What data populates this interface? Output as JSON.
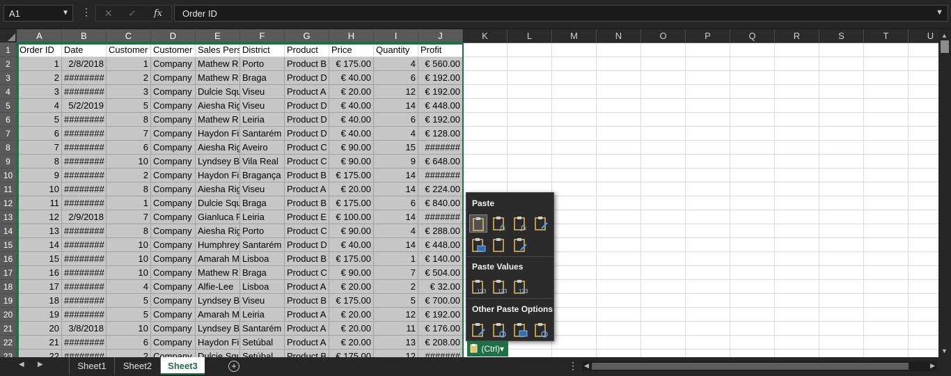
{
  "formula_bar": {
    "name_box": "A1",
    "fx_label": "fx",
    "formula": "Order ID"
  },
  "columns": [
    "A",
    "B",
    "C",
    "D",
    "E",
    "F",
    "G",
    "H",
    "I",
    "J",
    "K",
    "L",
    "M",
    "N",
    "O",
    "P",
    "Q",
    "R",
    "S",
    "T",
    "U"
  ],
  "rows": [
    "1",
    "2",
    "3",
    "4",
    "5",
    "6",
    "7",
    "8",
    "9",
    "10",
    "11",
    "12",
    "13",
    "14",
    "15",
    "16",
    "17",
    "18",
    "19",
    "20",
    "21",
    "22",
    "23"
  ],
  "table": {
    "headers": [
      "Order ID",
      "Date",
      "Customer",
      "Customer",
      "Sales Pers",
      "District",
      "Product",
      "Price",
      "Quantity",
      "Profit"
    ],
    "data": [
      [
        "1",
        "2/8/2018",
        "1",
        "Company",
        "Mathew R",
        "Porto",
        "Product B",
        "€ 175.00",
        "4",
        "€ 560.00"
      ],
      [
        "2",
        "########",
        "2",
        "Company",
        "Mathew R",
        "Braga",
        "Product D",
        "€   40.00",
        "6",
        "€ 192.00"
      ],
      [
        "3",
        "########",
        "3",
        "Company",
        "Dulcie Squ",
        "Viseu",
        "Product A",
        "€   20.00",
        "12",
        "€ 192.00"
      ],
      [
        "4",
        "5/2/2019",
        "5",
        "Company",
        "Aiesha Rig",
        "Viseu",
        "Product D",
        "€   40.00",
        "14",
        "€ 448.00"
      ],
      [
        "5",
        "########",
        "8",
        "Company",
        "Mathew R",
        "Leiria",
        "Product D",
        "€   40.00",
        "6",
        "€ 192.00"
      ],
      [
        "6",
        "########",
        "7",
        "Company",
        "Haydon Fi",
        "Santarém",
        "Product D",
        "€   40.00",
        "4",
        "€ 128.00"
      ],
      [
        "7",
        "########",
        "6",
        "Company",
        "Aiesha Rig",
        "Aveiro",
        "Product C",
        "€   90.00",
        "15",
        "#######"
      ],
      [
        "8",
        "########",
        "10",
        "Company",
        "Lyndsey B",
        "Vila Real",
        "Product C",
        "€   90.00",
        "9",
        "€ 648.00"
      ],
      [
        "9",
        "########",
        "2",
        "Company",
        "Haydon Fi",
        "Bragança",
        "Product B",
        "€ 175.00",
        "14",
        "#######"
      ],
      [
        "10",
        "########",
        "8",
        "Company",
        "Aiesha Rig",
        "Viseu",
        "Product A",
        "€   20.00",
        "14",
        "€ 224.00"
      ],
      [
        "11",
        "########",
        "1",
        "Company",
        "Dulcie Squ",
        "Braga",
        "Product B",
        "€ 175.00",
        "6",
        "€ 840.00"
      ],
      [
        "12",
        "2/9/2018",
        "7",
        "Company",
        "Gianluca F",
        "Leiria",
        "Product E",
        "€ 100.00",
        "14",
        "#######"
      ],
      [
        "13",
        "########",
        "8",
        "Company",
        "Aiesha Rig",
        "Porto",
        "Product C",
        "€   90.00",
        "4",
        "€ 288.00"
      ],
      [
        "14",
        "########",
        "10",
        "Company",
        "Humphrey",
        "Santarém",
        "Product D",
        "€   40.00",
        "14",
        "€ 448.00"
      ],
      [
        "15",
        "########",
        "10",
        "Company",
        "Amarah M",
        "Lisboa",
        "Product B",
        "€ 175.00",
        "1",
        "€ 140.00"
      ],
      [
        "16",
        "########",
        "10",
        "Company",
        "Mathew R",
        "Braga",
        "Product C",
        "€   90.00",
        "7",
        "€ 504.00"
      ],
      [
        "17",
        "########",
        "4",
        "Company",
        "Alfie-Lee",
        "Lisboa",
        "Product A",
        "€   20.00",
        "2",
        "€   32.00"
      ],
      [
        "18",
        "########",
        "5",
        "Company",
        "Lyndsey B",
        "Viseu",
        "Product B",
        "€ 175.00",
        "5",
        "€ 700.00"
      ],
      [
        "19",
        "########",
        "5",
        "Company",
        "Amarah M",
        "Leiria",
        "Product A",
        "€   20.00",
        "12",
        "€ 192.00"
      ],
      [
        "20",
        "3/8/2018",
        "10",
        "Company",
        "Lyndsey B",
        "Santarém",
        "Product A",
        "€   20.00",
        "11",
        "€ 176.00"
      ],
      [
        "21",
        "########",
        "6",
        "Company",
        "Haydon Fi",
        "Setúbal",
        "Product A",
        "€   20.00",
        "13",
        "€ 208.00"
      ],
      [
        "22",
        "########",
        "2",
        "Company",
        "Dulcie Squ",
        "Setúbal",
        "Product B",
        "€ 175.00",
        "12",
        "#######"
      ]
    ]
  },
  "sheet_tabs": [
    "Sheet1",
    "Sheet2",
    "Sheet3"
  ],
  "active_sheet": "Sheet3",
  "paste_menu": {
    "section1": "Paste",
    "section2": "Paste Values",
    "section3": "Other Paste Options",
    "ctrl_label": "(Ctrl)",
    "ctrl_caret": "▾",
    "paste_icons": [
      "paste-icon",
      "paste-formulas-icon",
      "paste-formulas-number-formatting-icon",
      "keep-source-formatting-icon",
      "no-borders-icon",
      "keep-source-column-widths-icon",
      "transpose-icon"
    ],
    "value_icons": [
      "paste-values-icon",
      "values-number-formatting-icon",
      "values-source-formatting-icon"
    ],
    "other_icons": [
      "formatting-icon",
      "paste-link-icon",
      "picture-icon",
      "linked-picture-icon"
    ]
  },
  "colors": {
    "accent": "#1e7145",
    "selection": "#c6c6c6",
    "chrome": "#262626"
  }
}
